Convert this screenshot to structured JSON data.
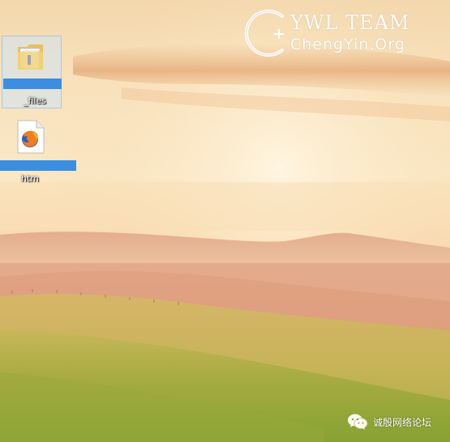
{
  "desktop": {
    "wallpaper": {
      "description_icon": "landscape-hills-sunset-wallpaper",
      "colors": {
        "sky_top": "#f6ddb4",
        "sky_glow": "#fff4dc",
        "haze": "#f4c899",
        "hill_far": "#e3a787",
        "hill_mid": "#d79877",
        "grass_light": "#c9b45a",
        "grass_dark": "#8da536"
      }
    },
    "icons": [
      {
        "type": "folder",
        "icon_name": "folder-icon",
        "label_suffix": "_files",
        "selected": true
      },
      {
        "type": "html-file",
        "icon_name": "firefox-html-file-icon",
        "label_suffix": "htm",
        "selected": true
      }
    ],
    "selection_color": "#3b8ee0"
  },
  "watermark": {
    "title": "YWL TEAM",
    "subtitle": "ChengYin.Org",
    "logo_icon": "c-plus-logo-icon"
  },
  "wechat_badge": {
    "icon_name": "wechat-icon",
    "text": "诚殷网络论坛"
  }
}
